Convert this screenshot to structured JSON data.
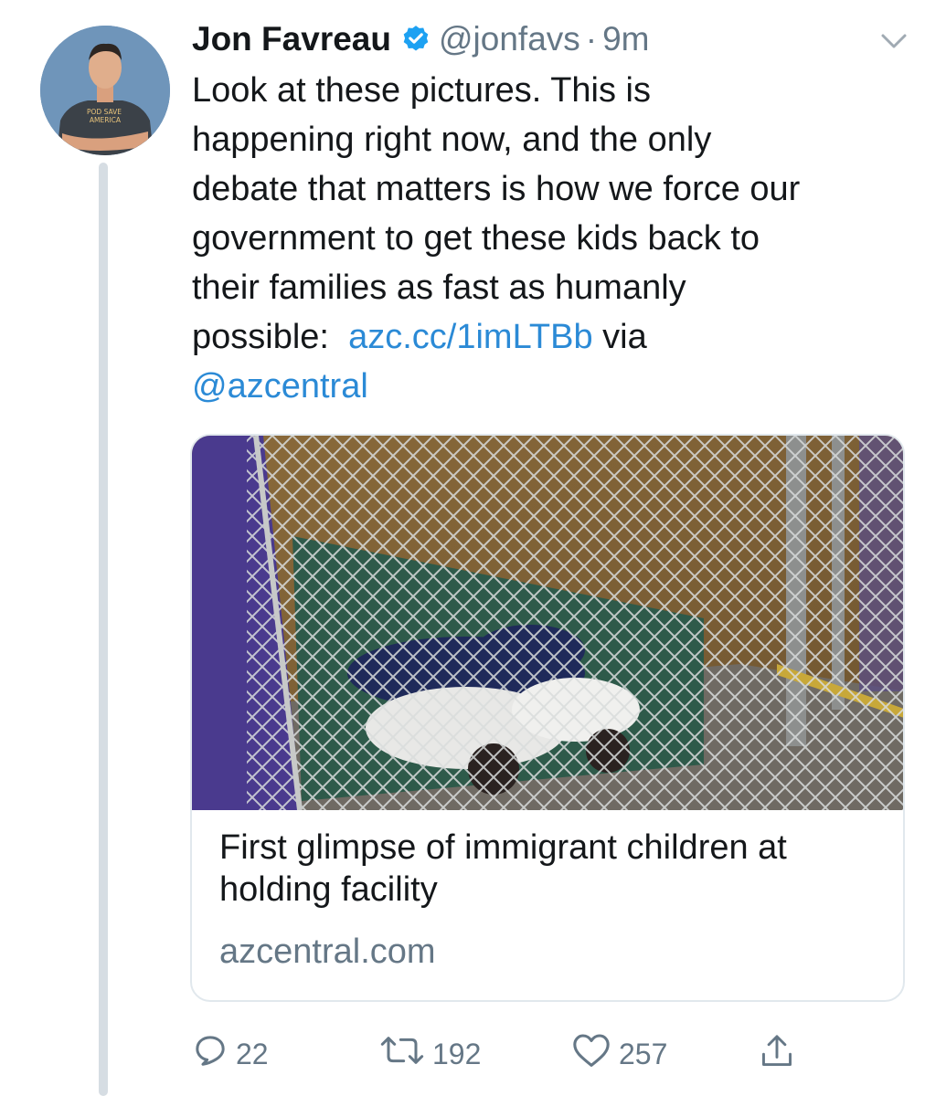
{
  "tweet": {
    "author_name": "Jon Favreau",
    "handle": "@jonfavs",
    "separator": "·",
    "time": "9m",
    "text_lines": [
      "Look at these pictures. This is",
      "happening right now, and the only",
      "debate that matters is how we force our",
      "government to get these kids back to",
      "their families as fast as humanly"
    ],
    "text_last_prefix": "possible:",
    "link": "azc.cc/1imLTBb",
    "via": "via",
    "mention": "@azcentral"
  },
  "avatar": {
    "shirt_text_line1": "POD SAVE",
    "shirt_text_line2": "AMERICA"
  },
  "card": {
    "title": "First glimpse of immigrant children at holding facility",
    "domain": "azcentral.com"
  },
  "actions": {
    "reply_count": "22",
    "retweet_count": "192",
    "like_count": "257"
  },
  "colors": {
    "link": "#2b8ad6",
    "secondary_text": "#657786",
    "verified": "#1da1f2"
  },
  "icons": {
    "verified": "verified-badge-icon",
    "caret": "chevron-down-icon",
    "reply": "reply-icon",
    "retweet": "retweet-icon",
    "like": "heart-icon",
    "share": "share-icon"
  }
}
